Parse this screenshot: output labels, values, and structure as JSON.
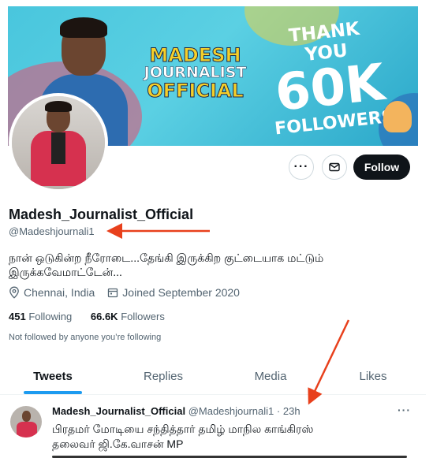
{
  "banner": {
    "line1": "MADESH",
    "line2": "JOURNALIST",
    "line3": "OFFICIAL",
    "thank_you": "THANK YOU",
    "count": "60K",
    "followers_word": "FOLLOWERS"
  },
  "actions": {
    "more_label": "···",
    "follow_label": "Follow"
  },
  "profile": {
    "display_name": "Madesh_Journalist_Official",
    "handle": "@Madeshjournali1",
    "bio_line1": "நான் ஒடுகின்ற நீரோடை...தேங்கி இருக்கிற குட்டையாக மட்டும்",
    "bio_line2": "இருக்கவேமாட்டேன்...",
    "location": "Chennai, India",
    "joined": "Joined September 2020",
    "following_count": "451",
    "following_label": "Following",
    "followers_count": "66.6K",
    "followers_label": "Followers",
    "not_followed": "Not followed by anyone you’re following"
  },
  "tabs": [
    {
      "label": "Tweets",
      "active": true
    },
    {
      "label": "Replies",
      "active": false
    },
    {
      "label": "Media",
      "active": false
    },
    {
      "label": "Likes",
      "active": false
    }
  ],
  "tweet": {
    "author": "Madesh_Journalist_Official",
    "handle": "@Madeshjournali1",
    "separator": "·",
    "time": "23h",
    "more_label": "···",
    "text_line1": "பிரதமர் மோடியை சந்தித்தார் தமிழ் மாநில காங்கிரஸ்",
    "text_line2": "தலைவர் ஜி.கே.வாசன் MP"
  },
  "colors": {
    "accent": "#1d9bf0",
    "annotation_arrow": "#e8401c",
    "follow_button": "#0f1419",
    "muted_text": "#536471"
  },
  "icons": [
    "more-icon",
    "mail-icon",
    "location-pin-icon",
    "calendar-icon"
  ]
}
